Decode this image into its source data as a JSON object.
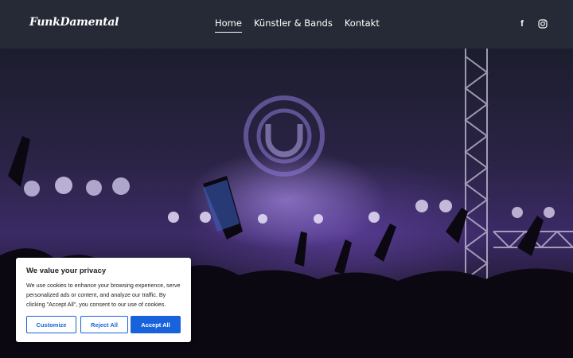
{
  "header": {
    "logo": "FunkDamental",
    "nav": [
      {
        "label": "Home",
        "active": true
      },
      {
        "label": "Künstler & Bands"
      },
      {
        "label": "Kontakt"
      }
    ],
    "social": [
      {
        "icon": "facebook-icon",
        "glyph": "f"
      },
      {
        "icon": "instagram-icon"
      }
    ]
  },
  "hero": {
    "image": "concert-crowd-stage",
    "accent": "#6b4bc8"
  },
  "cookie": {
    "title": "We value your privacy",
    "text": "We use cookies to enhance your browsing experience, serve personalized ads or content, and analyze our traffic. By clicking \"Accept All\", you consent to our use of cookies.",
    "buttons": {
      "customize": "Customize",
      "reject": "Reject All",
      "accept": "Accept All"
    },
    "accent_color": "#1863dc"
  }
}
